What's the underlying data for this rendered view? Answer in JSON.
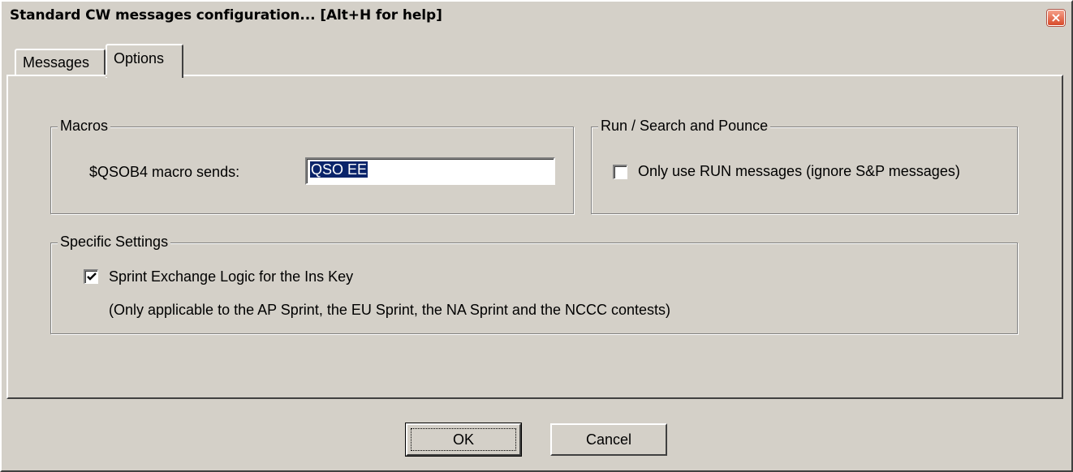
{
  "window": {
    "title": "Standard CW messages configuration... [Alt+H for help]",
    "close_glyph": "×"
  },
  "tabs": [
    {
      "label": "Messages",
      "selected": false
    },
    {
      "label": "Options",
      "selected": true
    }
  ],
  "macros": {
    "legend": "Macros",
    "qsob4_label": "$QSOB4 macro sends:",
    "qsob4_value": "QSO EE"
  },
  "run_sp": {
    "legend": "Run / Search and Pounce",
    "only_run_label": "Only use RUN messages (ignore S&P messages)",
    "only_run_checked": false
  },
  "specific": {
    "legend": "Specific Settings",
    "sprint_label": "Sprint Exchange Logic for the Ins Key",
    "sprint_checked": true,
    "sprint_note": "(Only applicable to the AP Sprint, the EU Sprint, the NA Sprint and the NCCC contests)"
  },
  "buttons": {
    "ok": "OK",
    "cancel": "Cancel"
  },
  "colors": {
    "face": "#d4d0c8",
    "selection": "#0a246a",
    "close": "#d84a2a"
  }
}
